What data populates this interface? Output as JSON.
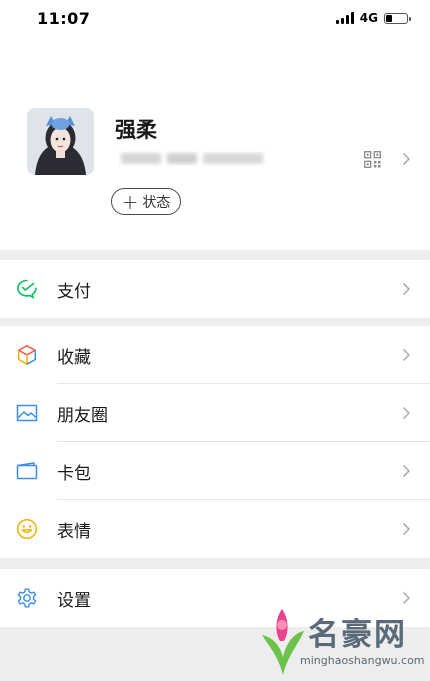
{
  "status_bar": {
    "time": "11:07",
    "network": "4G",
    "battery_level": 0.3
  },
  "profile": {
    "nickname": "强柔",
    "status_button": "状态"
  },
  "menu": {
    "pay": {
      "label": "支付",
      "icon": "wechat-pay-icon",
      "color": "#07c160"
    },
    "favorites": {
      "label": "收藏",
      "icon": "cube-icon"
    },
    "moments": {
      "label": "朋友圈",
      "icon": "picture-icon",
      "color": "#3d8fe6"
    },
    "cards": {
      "label": "卡包",
      "icon": "card-icon",
      "color": "#3d8fe6"
    },
    "stickers": {
      "label": "表情",
      "icon": "smiley-icon",
      "color": "#f2b100"
    },
    "settings": {
      "label": "设置",
      "icon": "gear-icon",
      "color": "#3d8fe6"
    }
  },
  "watermark": {
    "title": "名豪网",
    "url": "minghaoshangwu.com"
  }
}
